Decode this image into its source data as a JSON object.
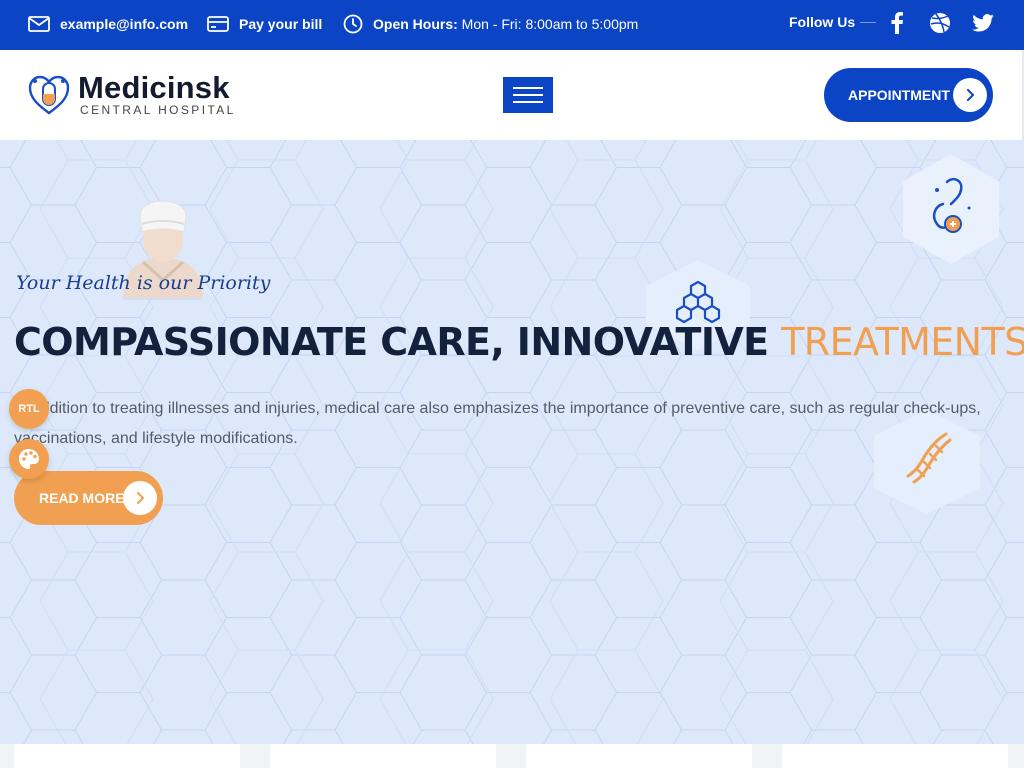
{
  "topbar": {
    "email": "example@info.com",
    "pay_bill": "Pay your bill",
    "hours_label": "Open Hours:",
    "hours_value": "Mon - Fri: 8:00am to 5:00pm",
    "follow": "Follow Us",
    "social_icons": [
      "facebook-icon",
      "dribbble-icon",
      "twitter-icon"
    ]
  },
  "header": {
    "logo_name": "Medicinsk",
    "logo_sub": "CENTRAL HOSPITAL",
    "appointment": "APPOINTMENT"
  },
  "hero": {
    "tagline": "Your Health is our Priority",
    "headline_main": "COMPASSIONATE CARE, INNOVATIVE",
    "headline_accent": "TREATMENTS",
    "description": "In addition to treating illnesses and injuries, medical care also emphasizes the importance of preventive care, such as regular check-ups, vaccinations, and lifestyle modifications.",
    "read_more": "READ MORE"
  },
  "floating": {
    "rtl": "RTL"
  },
  "colors": {
    "primary": "#0b44c4",
    "accent": "#f0a050",
    "hero_bg": "#dde9fb",
    "heading": "#14213d"
  }
}
